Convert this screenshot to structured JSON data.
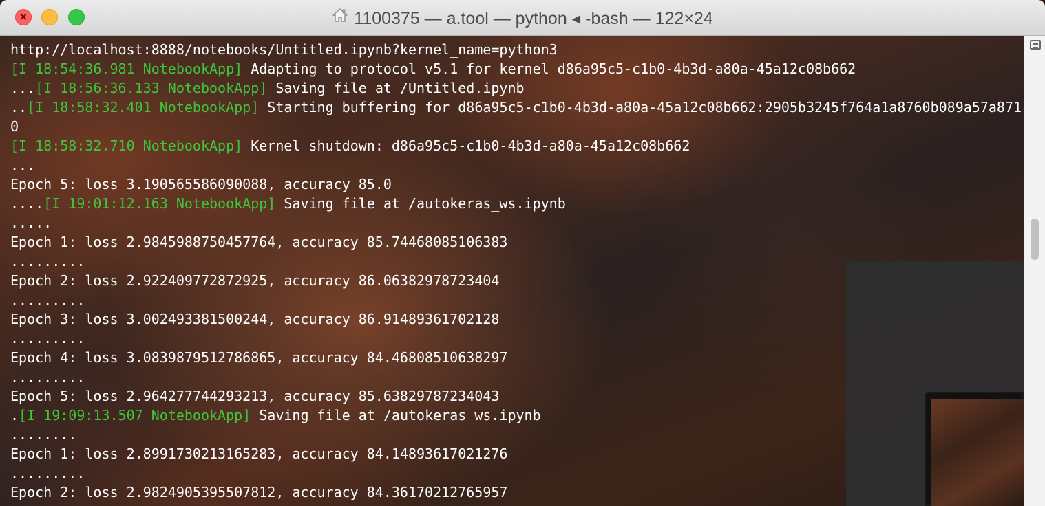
{
  "window": {
    "title": "1100375 — a.tool — python ◂ -bash — 122×24",
    "icon": "home-icon"
  },
  "terminal": {
    "lines": [
      [
        {
          "t": "http://localhost:8888/notebooks/Untitled.ipynb?kernel_name=python3",
          "c": "white"
        }
      ],
      [
        {
          "t": "[I 18:54:36.981 NotebookApp]",
          "c": "green"
        },
        {
          "t": " Adapting to protocol v5.1 for kernel d86a95c5-c1b0-4b3d-a80a-45a12c08b662",
          "c": "white"
        }
      ],
      [
        {
          "t": "...",
          "c": "white"
        },
        {
          "t": "[I 18:56:36.133 NotebookApp]",
          "c": "green"
        },
        {
          "t": " Saving file at /Untitled.ipynb",
          "c": "white"
        }
      ],
      [
        {
          "t": "..",
          "c": "white"
        },
        {
          "t": "[I 18:58:32.401 NotebookApp]",
          "c": "green"
        },
        {
          "t": " Starting buffering for d86a95c5-c1b0-4b3d-a80a-45a12c08b662:2905b3245f764a1a8760b089a57a871",
          "c": "white"
        }
      ],
      [
        {
          "t": "0",
          "c": "white"
        }
      ],
      [
        {
          "t": "[I 18:58:32.710 NotebookApp]",
          "c": "green"
        },
        {
          "t": " Kernel shutdown: d86a95c5-c1b0-4b3d-a80a-45a12c08b662",
          "c": "white"
        }
      ],
      [
        {
          "t": "...",
          "c": "white"
        }
      ],
      [
        {
          "t": "Epoch 5: loss 3.190565586090088, accuracy 85.0",
          "c": "white"
        }
      ],
      [
        {
          "t": "....",
          "c": "white"
        },
        {
          "t": "[I 19:01:12.163 NotebookApp]",
          "c": "green"
        },
        {
          "t": " Saving file at /autokeras_ws.ipynb",
          "c": "white"
        }
      ],
      [
        {
          "t": ".....",
          "c": "white"
        }
      ],
      [
        {
          "t": "Epoch 1: loss 2.9845988750457764, accuracy 85.74468085106383",
          "c": "white"
        }
      ],
      [
        {
          "t": ".........",
          "c": "white"
        }
      ],
      [
        {
          "t": "Epoch 2: loss 2.922409772872925, accuracy 86.06382978723404",
          "c": "white"
        }
      ],
      [
        {
          "t": ".........",
          "c": "white"
        }
      ],
      [
        {
          "t": "Epoch 3: loss 3.002493381500244, accuracy 86.91489361702128",
          "c": "white"
        }
      ],
      [
        {
          "t": ".........",
          "c": "white"
        }
      ],
      [
        {
          "t": "Epoch 4: loss 3.0839879512786865, accuracy 84.46808510638297",
          "c": "white"
        }
      ],
      [
        {
          "t": ".........",
          "c": "white"
        }
      ],
      [
        {
          "t": "Epoch 5: loss 2.964277744293213, accuracy 85.63829787234043",
          "c": "white"
        }
      ],
      [
        {
          "t": ".",
          "c": "white"
        },
        {
          "t": "[I 19:09:13.507 NotebookApp]",
          "c": "green"
        },
        {
          "t": " Saving file at /autokeras_ws.ipynb",
          "c": "white"
        }
      ],
      [
        {
          "t": "........",
          "c": "white"
        }
      ],
      [
        {
          "t": "Epoch 1: loss 2.8991730213165283, accuracy 84.14893617021276",
          "c": "white"
        }
      ],
      [
        {
          "t": ".........",
          "c": "white"
        }
      ],
      [
        {
          "t": "Epoch 2: loss 2.9824905395507812, accuracy 84.36170212765957",
          "c": "white"
        }
      ]
    ]
  },
  "colors": {
    "log_prefix": "#3fc43b",
    "text": "#ffffff",
    "close": "#fc605c",
    "minimize": "#fdbc40",
    "zoom": "#34c84a"
  }
}
